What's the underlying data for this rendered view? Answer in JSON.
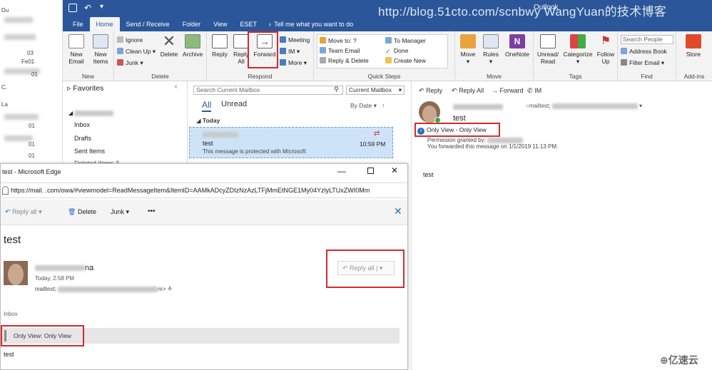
{
  "watermark": "http://blog.51cto.com/scnbwy WangYuan的技术博客",
  "left_strip": {
    "items": [
      "Du",
      "03",
      "Fe01",
      "01",
      "C.",
      "La",
      "01",
      "01",
      "01"
    ]
  },
  "titlebar": {
    "title": "Outlook"
  },
  "tabs": [
    "File",
    "Home",
    "Send / Receive",
    "Folder",
    "View",
    "ESET"
  ],
  "tell_me": "Tell me what you want to do",
  "ribbon": {
    "new": {
      "new_email": "New\nEmail",
      "new_items": "New\nItems",
      "label": "New"
    },
    "delete": {
      "ignore": "Ignore",
      "clean_up": "Clean Up",
      "junk": "Junk",
      "delete": "Delete",
      "archive": "Archive",
      "label": "Delete"
    },
    "respond": {
      "reply": "Reply",
      "reply_all": "Reply\nAll",
      "forward": "Forward",
      "meeting": "Meeting",
      "im": "IM",
      "more": "More",
      "label": "Respond"
    },
    "quick_steps": {
      "move_to": "Move to: ?",
      "team_email": "Team Email",
      "reply_delete": "Reply & Delete",
      "to_manager": "To Manager",
      "done": "Done",
      "create_new": "Create New",
      "label": "Quick Steps"
    },
    "move": {
      "move": "Move",
      "rules": "Rules",
      "onenote": "OneNote",
      "label": "Move"
    },
    "tags": {
      "unread_read": "Unread/\nRead",
      "categorize": "Categorize",
      "follow_up": "Follow\nUp",
      "label": "Tags"
    },
    "find": {
      "search_people": "Search People",
      "address_book": "Address Book",
      "filter_email": "Filter Email",
      "label": "Find"
    },
    "addins": {
      "store": "Store",
      "label": "Add-ins"
    }
  },
  "folders": {
    "favorites": "Favorites",
    "items": [
      "Inbox",
      "Drafts",
      "Sent Items",
      "Deleted Items"
    ],
    "deleted_count": "3"
  },
  "msglist": {
    "search_placeholder": "Search Current Mailbox",
    "scope": "Current Mailbox",
    "tab_all": "All",
    "tab_unread": "Unread",
    "sort": "By Date",
    "group_today": "Today",
    "item": {
      "subject": "test",
      "preview": "This message is protected with Microsoft",
      "time": "10:59 PM"
    }
  },
  "reading": {
    "reply": "Reply",
    "reply_all": "Reply All",
    "forward": "Forward",
    "im": "IM",
    "subject": "test",
    "to": "mailtest;",
    "policy": "Only View - Only View",
    "permission": "Permission granted by:",
    "forwarded_note": "You forwarded this message on 1/1/2019 11:13 PM.",
    "body": "test"
  },
  "edge": {
    "title": "test - Microsoft Edge",
    "url": "https://mail.          .com/owa/#viewmodel=ReadMessageItem&ItemID=AAMkADcyZDIzNzAzLTFjMmEtNGE1My04YzlyLTUxZWI0Mm",
    "toolbar": {
      "reply_all": "Reply all",
      "delete": "Delete",
      "junk": "Junk",
      "more": "•••"
    },
    "subject": "test",
    "sender_suffix": "na",
    "date": "Today, 2:58 PM",
    "to": "mailtest;",
    "reply_all_btn": "Reply all",
    "folder": "Inbox",
    "policy": "Only View: Only View",
    "body": "test"
  },
  "logo": "⊕亿速云"
}
